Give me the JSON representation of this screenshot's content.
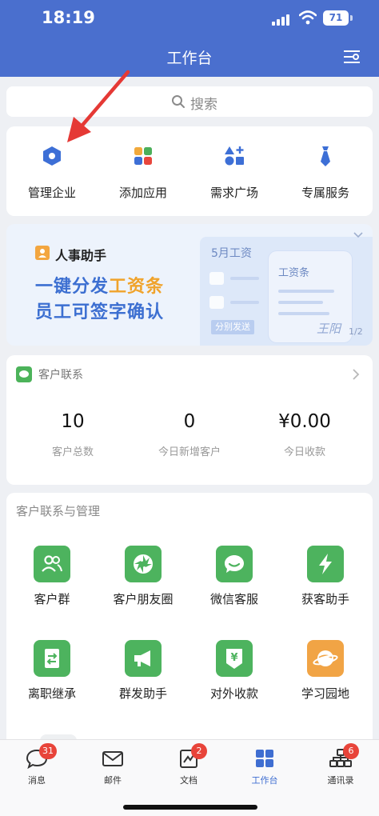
{
  "status_bar": {
    "time": "18:19",
    "battery": "71"
  },
  "header": {
    "title": "工作台"
  },
  "search": {
    "placeholder": "搜索"
  },
  "quick_actions": [
    {
      "label": "管理企业",
      "icon": "hexagon-icon"
    },
    {
      "label": "添加应用",
      "icon": "grid-apps-icon"
    },
    {
      "label": "需求广场",
      "icon": "shapes-plus-icon"
    },
    {
      "label": "专属服务",
      "icon": "tie-icon"
    }
  ],
  "banner": {
    "title": "人事助手",
    "line1_a": "一键分发",
    "line1_b": "工资条",
    "line2": "员工可签字确认",
    "panel_title": "5月工资",
    "panel_button": "分别发送",
    "card_title": "工资条",
    "signature": "王阳",
    "pager": "1/2"
  },
  "customer_stats": {
    "title": "客户联系",
    "items": [
      {
        "value": "10",
        "label": "客户总数"
      },
      {
        "value": "0",
        "label": "今日新增客户"
      },
      {
        "value": "¥0.00",
        "label": "今日收款"
      }
    ]
  },
  "apps": {
    "title": "客户联系与管理",
    "items": [
      {
        "label": "客户群",
        "icon": "customer-group-icon"
      },
      {
        "label": "客户朋友圈",
        "icon": "moments-icon"
      },
      {
        "label": "微信客服",
        "icon": "wechat-service-icon"
      },
      {
        "label": "获客助手",
        "icon": "lightning-icon"
      },
      {
        "label": "离职继承",
        "icon": "transfer-icon"
      },
      {
        "label": "群发助手",
        "icon": "megaphone-icon"
      },
      {
        "label": "对外收款",
        "icon": "payment-icon"
      },
      {
        "label": "学习园地",
        "icon": "planet-icon"
      }
    ]
  },
  "tabbar": [
    {
      "label": "消息",
      "badge": "31",
      "icon": "message-icon"
    },
    {
      "label": "邮件",
      "badge": "",
      "icon": "mail-icon"
    },
    {
      "label": "文档",
      "badge": "2",
      "icon": "document-icon"
    },
    {
      "label": "工作台",
      "badge": "",
      "icon": "workspace-icon",
      "active": true
    },
    {
      "label": "通讯录",
      "badge": "6",
      "icon": "contacts-icon"
    }
  ],
  "colors": {
    "header": "#4a6fce",
    "accent": "#3f6ed1",
    "app_green": "#4db35e",
    "app_orange": "#f1a445",
    "badge_red": "#e8443a",
    "annotation_arrow": "#e53935"
  }
}
